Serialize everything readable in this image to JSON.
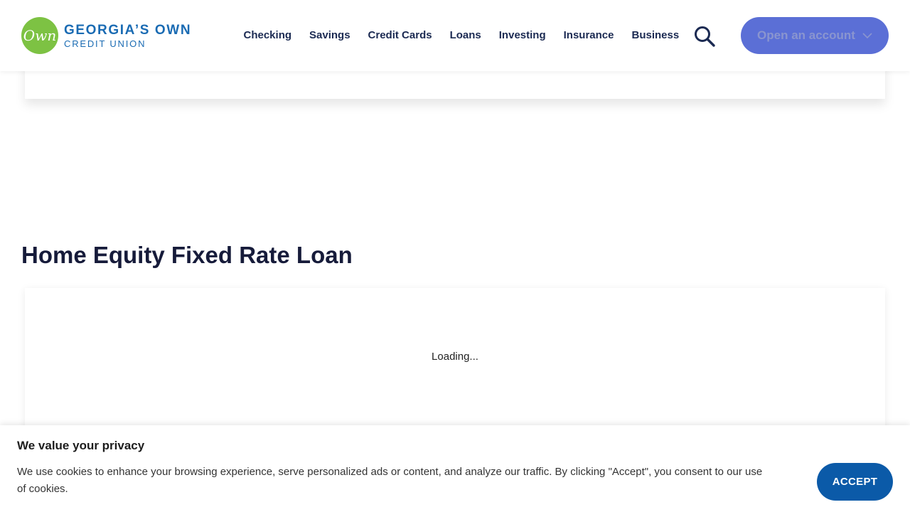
{
  "header": {
    "logo": {
      "mark_text": "Own",
      "line1": "GEORGIA’S OWN",
      "line2": "CREDIT UNION"
    },
    "nav": [
      {
        "label": "Checking"
      },
      {
        "label": "Savings"
      },
      {
        "label": "Credit Cards"
      },
      {
        "label": "Loans"
      },
      {
        "label": "Investing"
      },
      {
        "label": "Insurance"
      },
      {
        "label": "Business"
      }
    ],
    "search_icon": "search-icon",
    "open_account_label": "Open an account",
    "open_account_icon": "chevron-down-icon"
  },
  "main": {
    "section_title": "Home Equity Fixed Rate Loan",
    "loading_text": "Loading..."
  },
  "cookie_banner": {
    "title": "We value your privacy",
    "text": "We use cookies to enhance your browsing experience, serve personalized ads or content, and analyze our traffic. By clicking \"Accept\", you consent to our use of cookies.",
    "accept_label": "ACCEPT"
  },
  "colors": {
    "brand_green": "#7dc243",
    "brand_blue": "#1a6bb3",
    "button_purple": "#5b6fd6",
    "accept_blue": "#0b5aa8",
    "nav_text": "#1b2a52"
  }
}
